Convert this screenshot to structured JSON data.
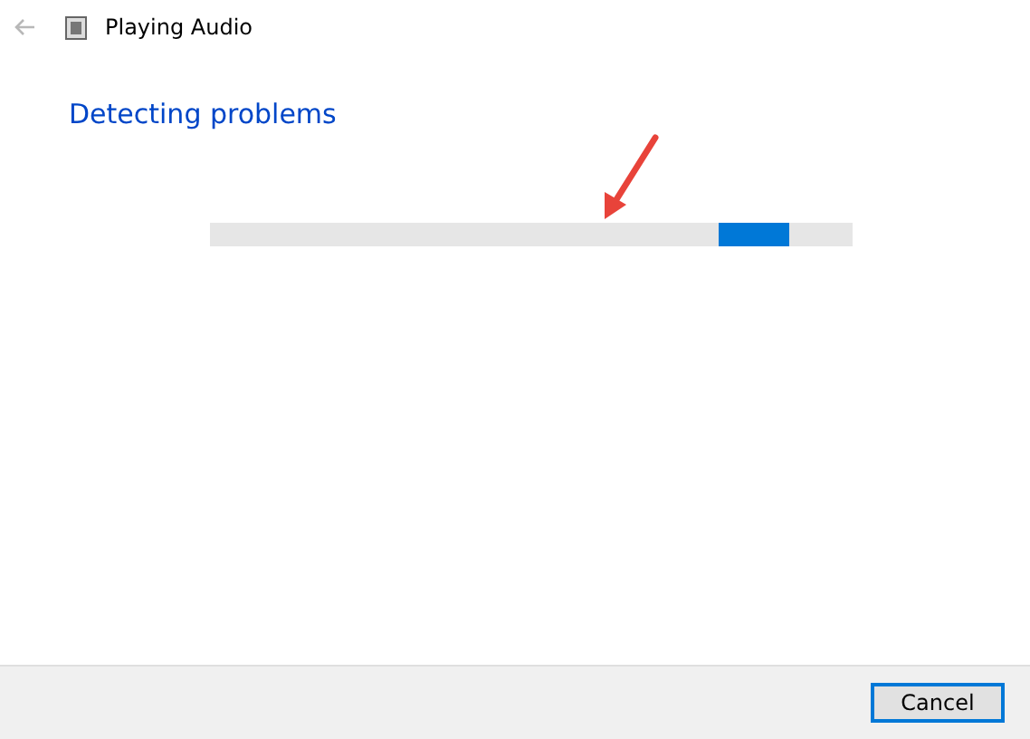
{
  "window": {
    "title": "Playing Audio",
    "back_disabled": true
  },
  "heading": "Detecting problems",
  "progress": {
    "kind": "indeterminate",
    "level": 0.9
  },
  "annotation": {
    "kind": "arrow"
  },
  "buttons": [
    {
      "label": "Cancel",
      "focused": true
    }
  ]
}
